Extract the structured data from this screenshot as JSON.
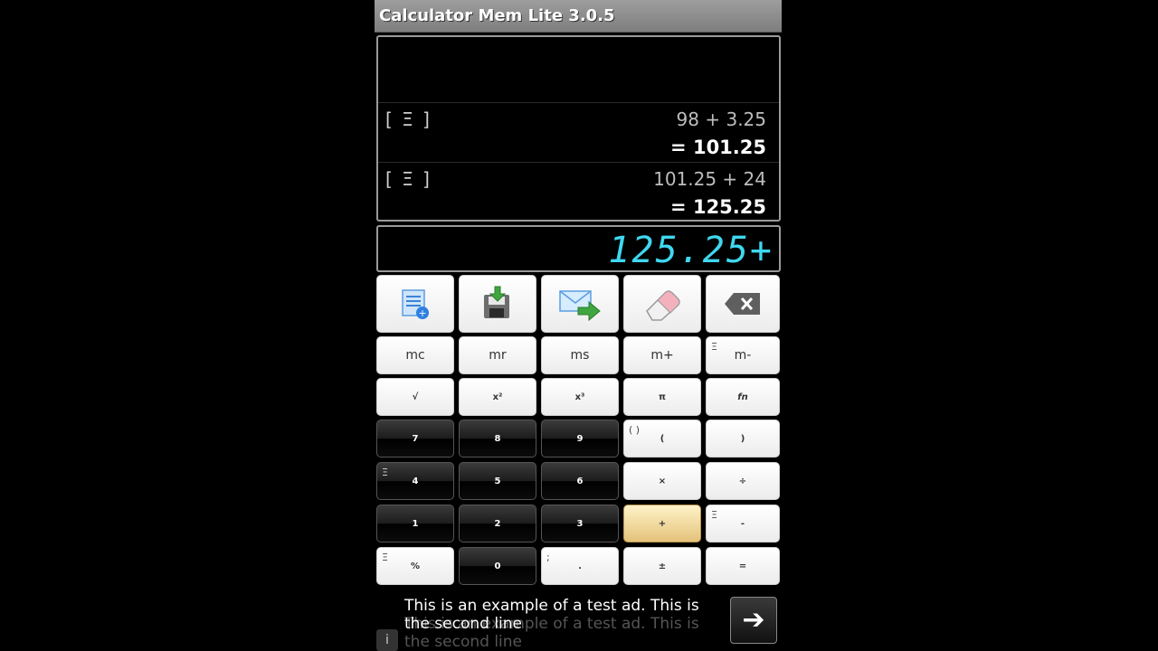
{
  "app": {
    "title": "Calculator Mem Lite 3.0.5"
  },
  "history": [
    {
      "menu": "[ Ξ ]",
      "expr": "98 + 3.25",
      "result": "= 101.25"
    },
    {
      "menu": "[ Ξ ]",
      "expr": "101.25 + 24",
      "result": "= 125.25"
    }
  ],
  "display": {
    "value": "125.25+"
  },
  "toolbar": {
    "list_icon": "notes-add-icon",
    "save_icon": "save-download-icon",
    "send_icon": "email-send-icon",
    "clear_icon": "eraser-icon",
    "backspace_icon": "backspace-icon"
  },
  "keys": {
    "mc": "mc",
    "mr": "mr",
    "ms": "ms",
    "mplus": "m+",
    "mminus": "m-",
    "sqrt": "√",
    "square": "x²",
    "cube": "x³",
    "pi": "π",
    "fn": "fn",
    "seven": "7",
    "eight": "8",
    "nine": "9",
    "open_paren": "(",
    "close_paren": ")",
    "four": "4",
    "five": "5",
    "six": "6",
    "multiply": "×",
    "divide": "÷",
    "one": "1",
    "two": "2",
    "three": "3",
    "plus": "+",
    "minus": "-",
    "percent": "%",
    "zero": "0",
    "dot": ".",
    "plusminus": "±",
    "equals": "=",
    "paren_corner": "( )",
    "menu_corner": "Ξ",
    "semicolon_corner": ";"
  },
  "ad": {
    "text": "This is an example of a test ad. This is the second line",
    "text_shadow": "This is an example of a test ad. This is the second line",
    "info": "i",
    "go": "➔"
  },
  "colors": {
    "display": "#3fd8f0",
    "title_bar": "#8f8f8f",
    "highlight_key": "#e4c27a"
  }
}
